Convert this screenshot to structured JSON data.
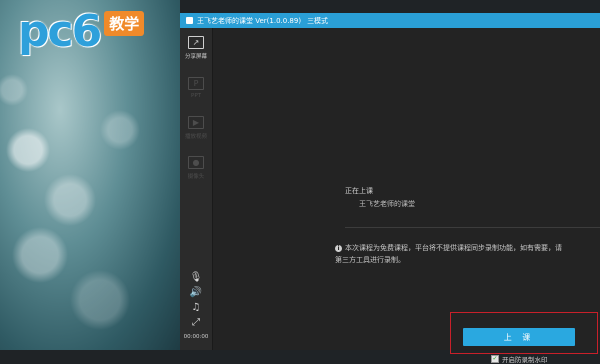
{
  "logo": {
    "brand": "pc6",
    "badge": "教学"
  },
  "window": {
    "title": "王飞艺老师的课堂 Ver(1.0.0.89)",
    "mode": "三模式"
  },
  "sidebar": {
    "items": [
      {
        "label": "分享屏幕",
        "icon": "share-screen-icon",
        "enabled": true
      },
      {
        "label": "PPT",
        "icon": "ppt-icon",
        "enabled": false
      },
      {
        "label": "播放视频",
        "icon": "play-video-icon",
        "enabled": false
      },
      {
        "label": "摄像头",
        "icon": "camera-icon",
        "enabled": false
      }
    ],
    "tools": [
      "microphone-muted-icon",
      "speaker-icon",
      "music-icon",
      "fullscreen-icon"
    ],
    "timer": "00:00:00"
  },
  "classroom": {
    "status": "正在上课",
    "class_name": "王飞艺老师的课堂",
    "notice_line1": "本次课程为免费课程，平台将不提供课程同步录制功能，如有需要，请",
    "notice_line2": "第三方工具进行录制。",
    "start_button": "上 课",
    "anti_record_label": "开启防录制水印",
    "anti_record_checked": true
  }
}
